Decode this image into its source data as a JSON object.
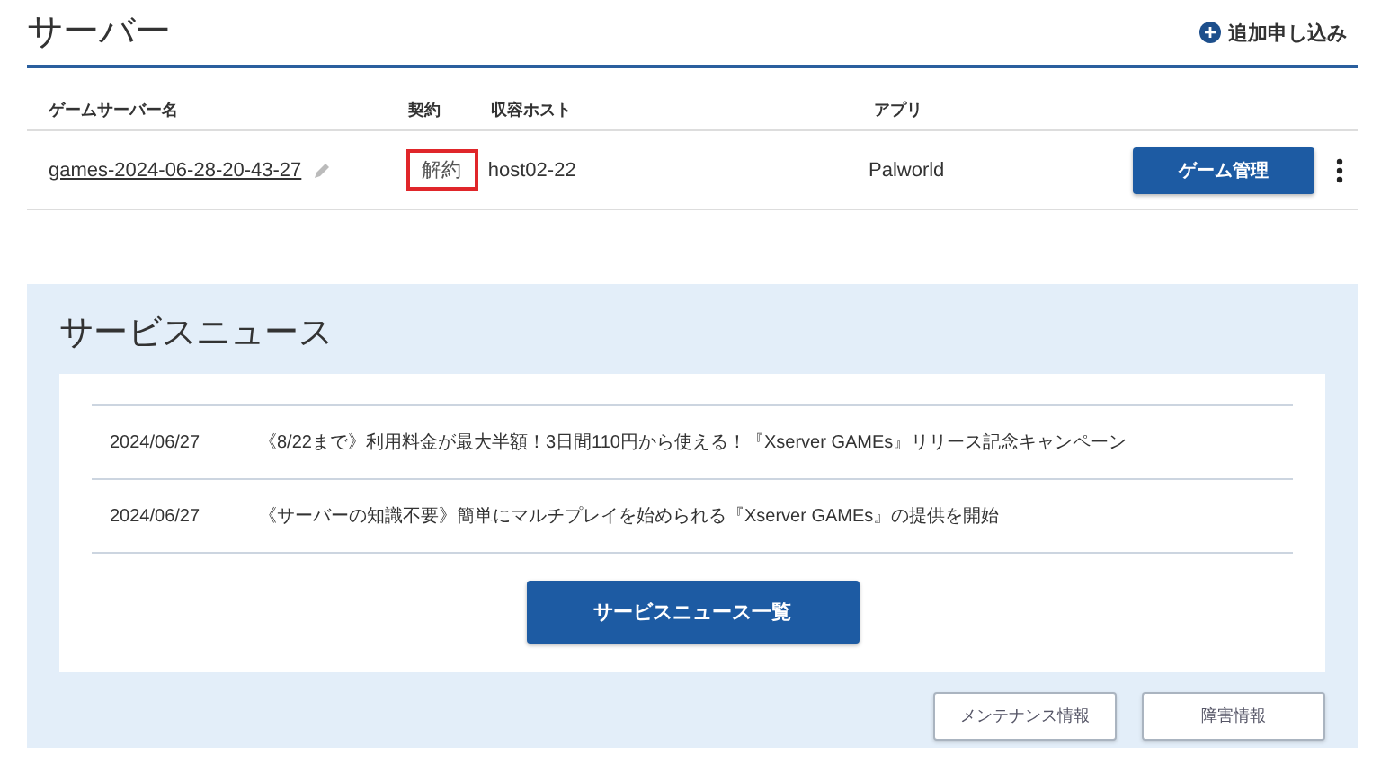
{
  "page_title": "サーバー",
  "add_link": {
    "icon": "+",
    "label": "追加申し込み"
  },
  "table": {
    "columns": [
      "ゲームサーバー名",
      "契約",
      "収容ホスト",
      "アプリ"
    ],
    "rows": [
      {
        "name": "games-2024-06-28-20-43-27",
        "contract": "解約",
        "contract_highlighted": true,
        "host": "host02-22",
        "app": "Palworld",
        "action": "ゲーム管理"
      }
    ]
  },
  "news": {
    "title": "サービスニュース",
    "items": [
      {
        "date": "2024/06/27",
        "text": "《8/22まで》利用料金が最大半額！3日間110円から使える！『Xserver GAMEs』リリース記念キャンペーン"
      },
      {
        "date": "2024/06/27",
        "text": "《サーバーの知識不要》簡単にマルチプレイを始められる『Xserver GAMEs』の提供を開始"
      }
    ],
    "list_button": "サービスニュース一覧"
  },
  "footer_buttons": [
    "メンテナンス情報",
    "障害情報"
  ]
}
